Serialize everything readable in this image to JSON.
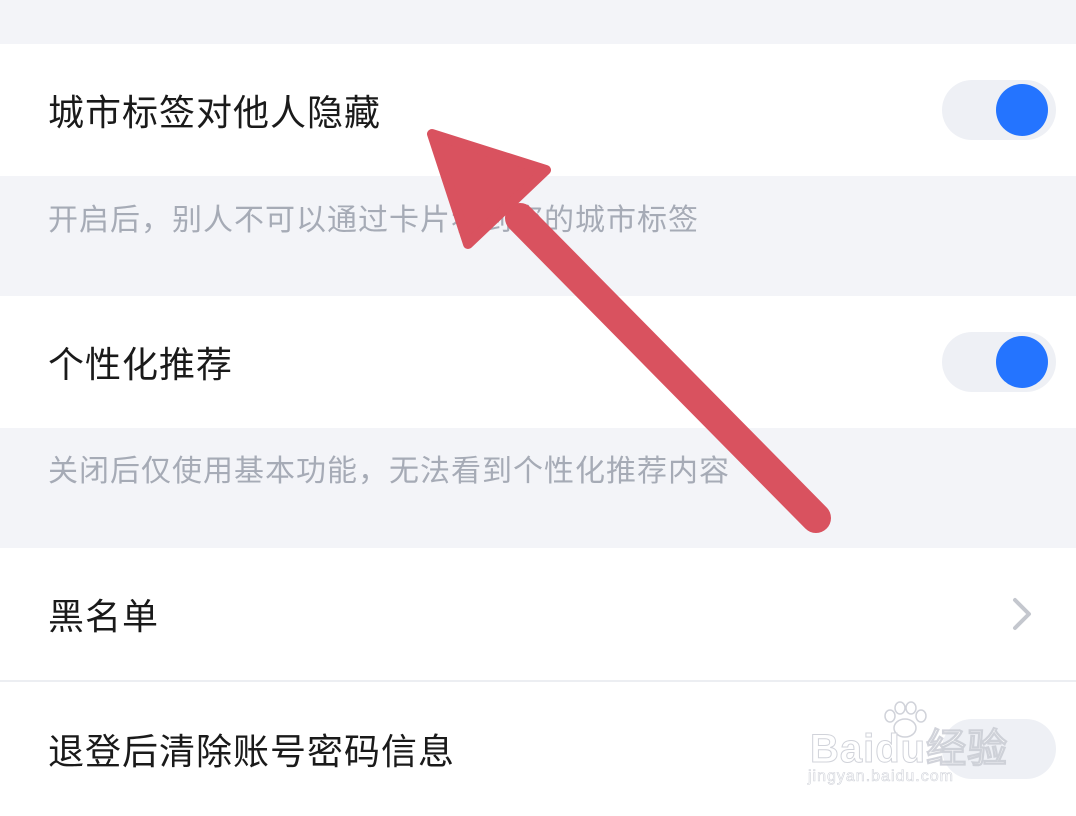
{
  "settings": {
    "items": [
      {
        "label": "城市标签对他人隐藏",
        "toggle_on": true,
        "hint": "开启后，别人不可以通过卡片看到您的城市标签"
      },
      {
        "label": "个性化推荐",
        "toggle_on": true,
        "hint": "关闭后仅使用基本功能，无法看到个性化推荐内容"
      },
      {
        "label": "黑名单",
        "icon": "chevron-right-icon"
      },
      {
        "label": "退登后清除账号密码信息",
        "toggle_on": true
      }
    ]
  },
  "colors": {
    "background": "#f3f4f8",
    "toggle_on": "#2474ff",
    "toggle_track": "#eef0f5",
    "hint_text": "#a6abb6",
    "annotation_arrow": "#d9525f"
  },
  "watermark": {
    "brand": "Baidu经验",
    "url": "jingyan.baidu.com",
    "icon": "paw-icon"
  }
}
